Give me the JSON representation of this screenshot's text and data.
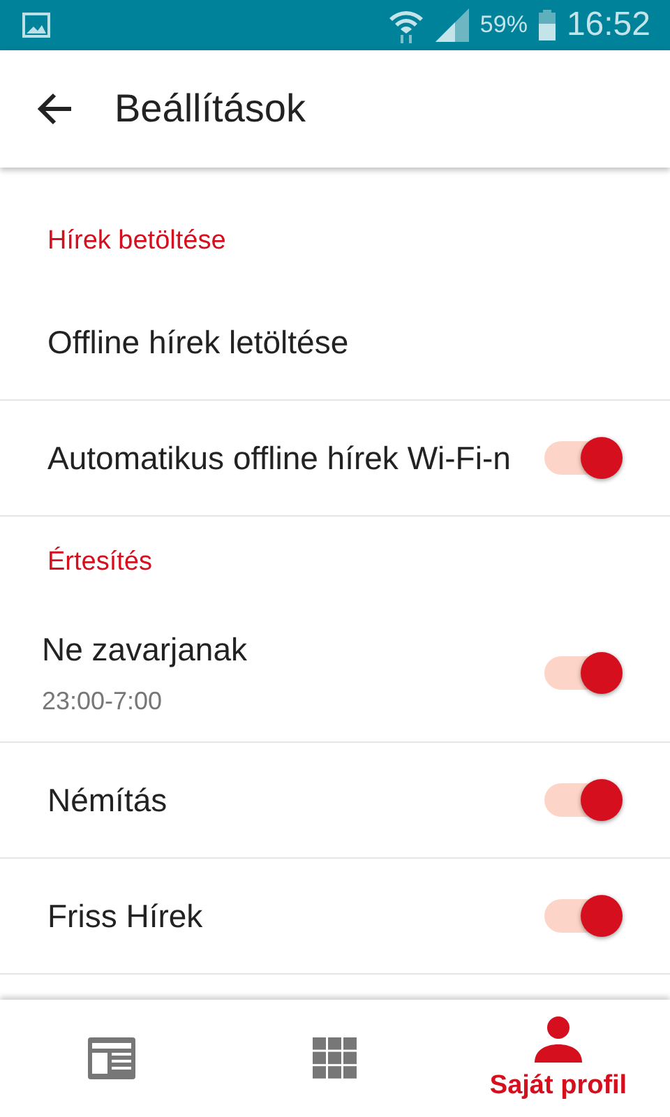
{
  "status_bar": {
    "battery": "59%",
    "time": "16:52"
  },
  "app_bar": {
    "title": "Beállítások"
  },
  "sections": [
    {
      "title": "Hírek betöltése",
      "items": [
        {
          "kind": "action",
          "label": "Offline hírek letöltése"
        },
        {
          "kind": "toggle",
          "label": "Automatikus offline hírek Wi-Fi-n",
          "on": true
        }
      ]
    },
    {
      "title": "Értesítés",
      "items": [
        {
          "kind": "toggle",
          "label": "Ne zavarjanak",
          "subtitle": "23:00-7:00",
          "on": true
        },
        {
          "kind": "toggle",
          "label": "Némítás",
          "on": true
        },
        {
          "kind": "toggle",
          "label": "Friss Hírek",
          "on": true
        }
      ]
    }
  ],
  "bottom_nav": [
    {
      "kind": "news",
      "selected": false
    },
    {
      "kind": "grid",
      "selected": false
    },
    {
      "kind": "person",
      "label": "Saját profil",
      "selected": true
    }
  ]
}
